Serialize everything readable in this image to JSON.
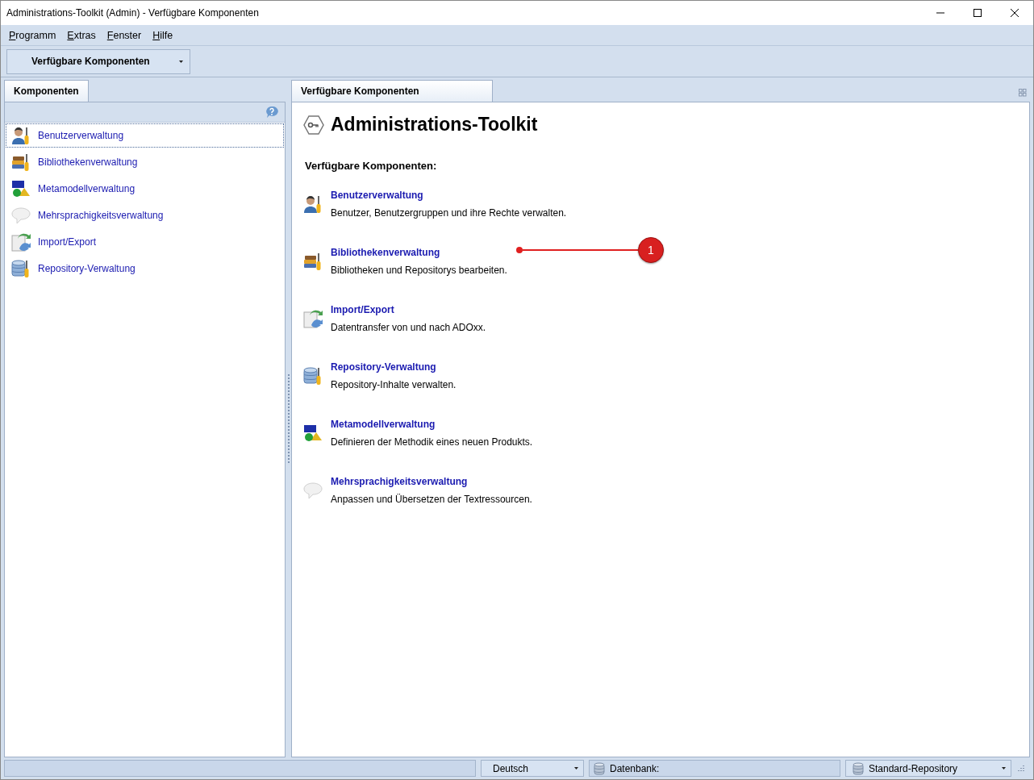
{
  "window": {
    "title": "Administrations-Toolkit (Admin) - Verfügbare Komponenten"
  },
  "menu": [
    {
      "mnemonic": "P",
      "rest": "rogramm"
    },
    {
      "mnemonic": "E",
      "rest": "xtras"
    },
    {
      "mnemonic": "F",
      "rest": "enster"
    },
    {
      "mnemonic": "H",
      "rest": "ilfe"
    }
  ],
  "toolbar": {
    "dropdown": "Verfügbare Komponenten"
  },
  "left_panel": {
    "tab": "Komponenten",
    "items": [
      {
        "kind": "user",
        "label": "Benutzerverwaltung",
        "selected": true
      },
      {
        "kind": "library",
        "label": "Bibliothekenverwaltung",
        "selected": false
      },
      {
        "kind": "metamodel",
        "label": "Metamodellverwaltung",
        "selected": false
      },
      {
        "kind": "speech",
        "label": "Mehrsprachigkeitsverwaltung",
        "selected": false
      },
      {
        "kind": "transfer",
        "label": "Import/Export",
        "selected": false
      },
      {
        "kind": "repository",
        "label": "Repository-Verwaltung",
        "selected": false
      }
    ]
  },
  "main_panel": {
    "tab": "Verfügbare Komponenten",
    "title": "Administrations-Toolkit",
    "subtitle": "Verfügbare Komponenten:",
    "components": [
      {
        "kind": "user",
        "name": "Benutzerverwaltung",
        "description": "Benutzer, Benutzergruppen und ihre Rechte verwalten."
      },
      {
        "kind": "library",
        "name": "Bibliothekenverwaltung",
        "description": "Bibliotheken und Repositorys bearbeiten.",
        "callout": "1"
      },
      {
        "kind": "transfer",
        "name": "Import/Export",
        "description": "Datentransfer von und nach ADOxx."
      },
      {
        "kind": "repository",
        "name": "Repository-Verwaltung",
        "description": "Repository-Inhalte verwalten."
      },
      {
        "kind": "metamodel",
        "name": "Metamodellverwaltung",
        "description": "Definieren der Methodik eines neuen Produkts."
      },
      {
        "kind": "speech",
        "name": "Mehrsprachigkeitsverwaltung",
        "description": "Anpassen und Übersetzen der Textressourcen."
      }
    ]
  },
  "status_bar": {
    "language": "Deutsch",
    "database": "Datenbank:",
    "repository": "Standard-Repository"
  }
}
